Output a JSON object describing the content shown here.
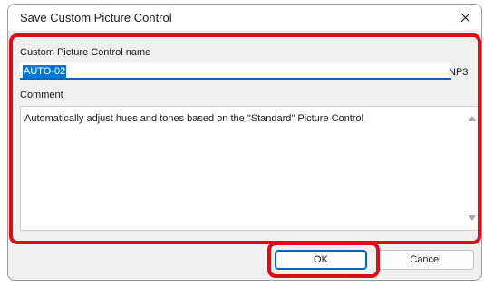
{
  "window": {
    "title": "Save Custom Picture Control",
    "close_symbol": "close-icon"
  },
  "form": {
    "name_label": "Custom Picture Control name",
    "name_value": "AUTO-02",
    "name_extension": "NP3",
    "comment_label": "Comment",
    "comment_value": "Automatically adjust hues and tones based on the \"Standard\" Picture Control"
  },
  "buttons": {
    "ok_label": "OK",
    "cancel_label": "Cancel"
  },
  "colors": {
    "highlight": "#e10a17",
    "selection": "#0078d7",
    "focus_underline": "#0067c0"
  }
}
